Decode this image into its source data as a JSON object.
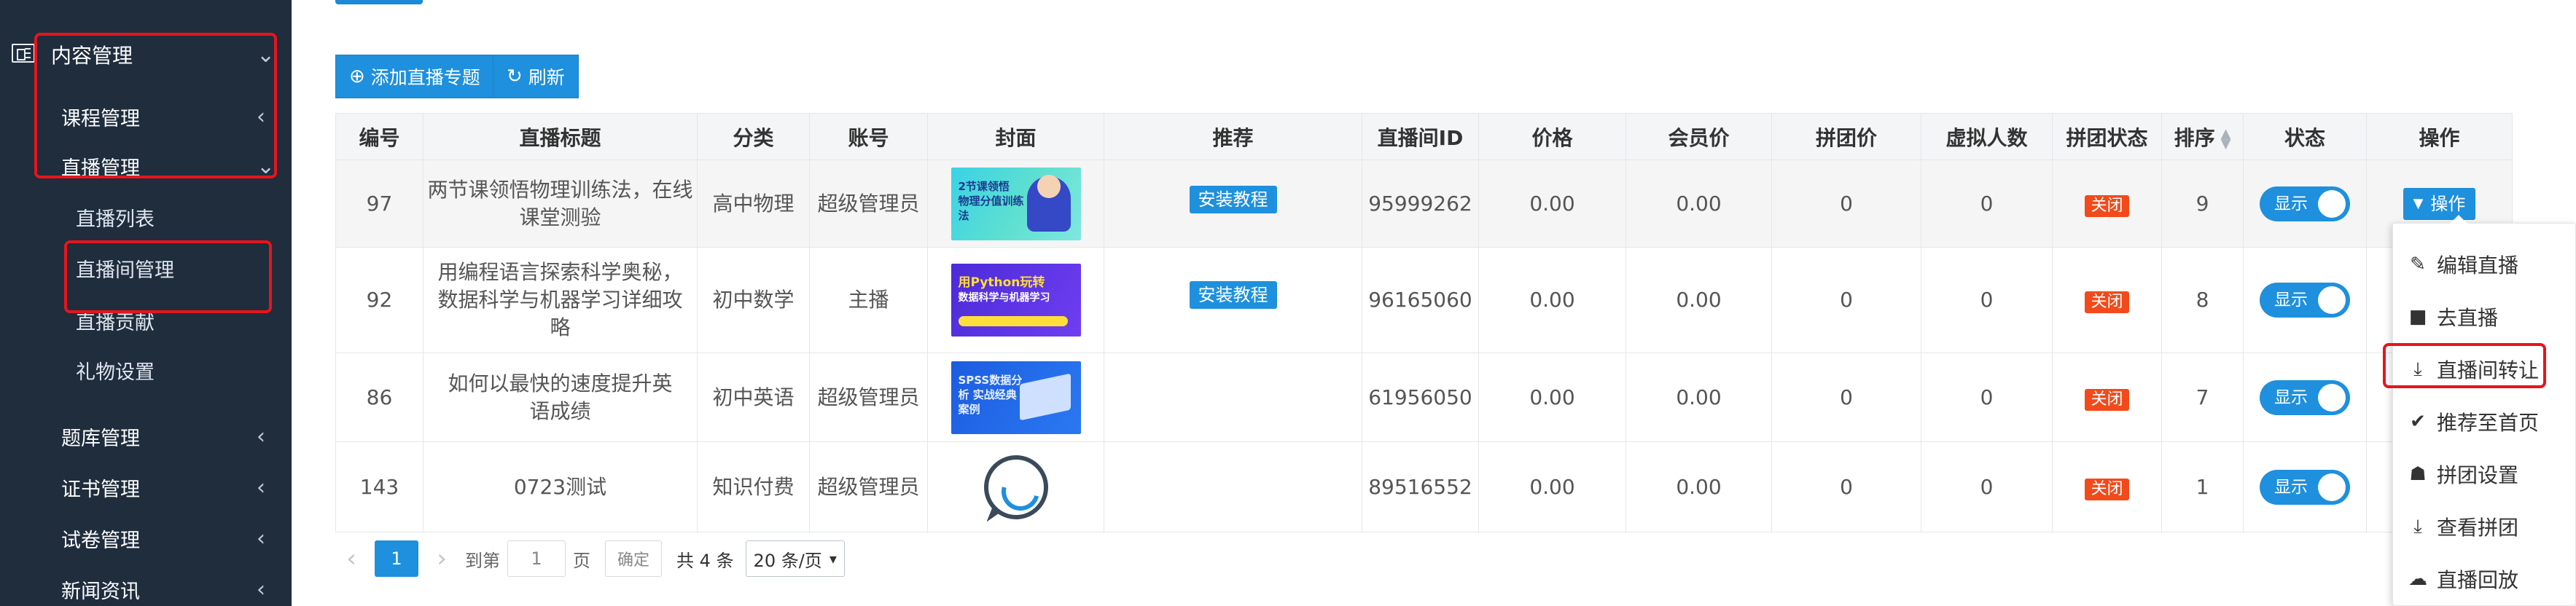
{
  "sidebar": {
    "items": [
      {
        "label": "内容管理",
        "chevron": "⌄"
      },
      {
        "label": "课程管理",
        "chevron": "‹"
      },
      {
        "label": "直播管理",
        "chevron": "⌄"
      },
      {
        "label": "直播列表"
      },
      {
        "label": "直播间管理"
      },
      {
        "label": "直播贡献"
      },
      {
        "label": "礼物设置"
      },
      {
        "label": "题库管理",
        "chevron": "‹"
      },
      {
        "label": "证书管理",
        "chevron": "‹"
      },
      {
        "label": "试卷管理",
        "chevron": "‹"
      },
      {
        "label": "新闻资讯",
        "chevron": "‹"
      }
    ]
  },
  "toolbar": {
    "add_label": "添加直播专题",
    "add_icon": "⊕",
    "refresh_label": "刷新",
    "refresh_icon": "↻"
  },
  "table": {
    "headers": [
      "编号",
      "直播标题",
      "分类",
      "账号",
      "封面",
      "推荐",
      "直播间ID",
      "价格",
      "会员价",
      "拼团价",
      "虚拟人数",
      "拼团状态",
      "排序",
      "状态",
      "操作"
    ],
    "rows": [
      {
        "id": "97",
        "title": "两节课领悟物理训练法，在线课堂测验",
        "category": "高中物理",
        "account": "超级管理员",
        "cover_text": "2节课领悟 物理分值训练法",
        "recommend": "安装教程",
        "room_id": "95999262",
        "price": "0.00",
        "member_price": "0.00",
        "group_price": "0",
        "virtual_count": "0",
        "group_status": "关闭",
        "sort": "9",
        "status": "显示",
        "op": "操作"
      },
      {
        "id": "92",
        "title": "用编程语言探索科学奥秘，数据科学与机器学习详细攻略",
        "category": "初中数学",
        "account": "主播",
        "cover_text_a": "用Python玩转",
        "cover_text_b": "数据科学与机器学习",
        "recommend": "安装教程",
        "room_id": "96165060",
        "price": "0.00",
        "member_price": "0.00",
        "group_price": "0",
        "virtual_count": "0",
        "group_status": "关闭",
        "sort": "8",
        "status": "显示"
      },
      {
        "id": "86",
        "title": "如何以最快的速度提升英语成绩",
        "category": "初中英语",
        "account": "超级管理员",
        "cover_text": "SPSS数据分析 实战经典案例",
        "recommend": "",
        "room_id": "61956050",
        "price": "0.00",
        "member_price": "0.00",
        "group_price": "0",
        "virtual_count": "0",
        "group_status": "关闭",
        "sort": "7",
        "status": "显示"
      },
      {
        "id": "143",
        "title": "0723测试",
        "category": "知识付费",
        "account": "超级管理员",
        "recommend": "",
        "room_id": "89516552",
        "price": "0.00",
        "member_price": "0.00",
        "group_price": "0",
        "virtual_count": "0",
        "group_status": "关闭",
        "sort": "1",
        "status": "显示"
      }
    ]
  },
  "pagination": {
    "prev": "‹",
    "current": "1",
    "next": "›",
    "goto_label": "到第",
    "goto_value": "1",
    "page_unit": "页",
    "confirm": "确定",
    "total": "共 4 条",
    "page_size": "20 条/页"
  },
  "dropdown": {
    "items": [
      {
        "label": "编辑直播",
        "icon": "edit-icon"
      },
      {
        "label": "去直播",
        "icon": "video-camera-icon"
      },
      {
        "label": "直播间转让",
        "icon": "transfer-icon"
      },
      {
        "label": "推荐至首页",
        "icon": "check-circle-icon"
      },
      {
        "label": "拼团设置",
        "icon": "group-icon"
      },
      {
        "label": "查看拼团",
        "icon": "view-group-icon"
      },
      {
        "label": "直播回放",
        "icon": "cloud-download-icon"
      }
    ]
  },
  "colors": {
    "sidebar_bg": "#1f2d3d",
    "accent": "#1e90dd",
    "danger_tag": "#f24a1a",
    "highlight": "#e8141c"
  }
}
